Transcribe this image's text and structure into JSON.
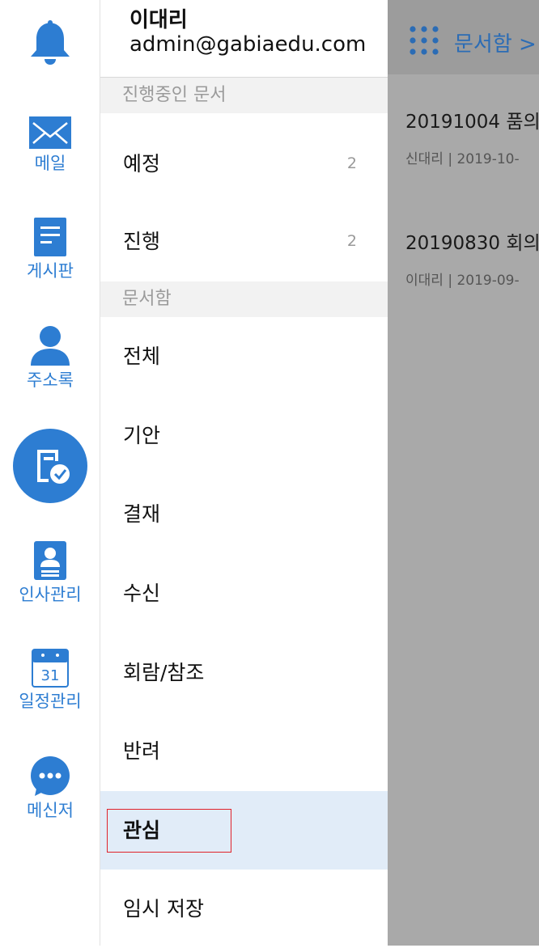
{
  "rail": {
    "items": [
      {
        "label": ""
      },
      {
        "label": "메일"
      },
      {
        "label": "게시판"
      },
      {
        "label": "주소록"
      },
      {
        "label": ""
      },
      {
        "label": "인사관리"
      },
      {
        "label": "일정관리"
      },
      {
        "label": "메신저"
      }
    ],
    "calendar_day": "31",
    "accent_color": "#2d7dd2"
  },
  "profile": {
    "name": "이대리",
    "email": "admin@gabiaedu.com"
  },
  "menu": {
    "section_in_progress": "진행중인 문서",
    "in_progress_items": [
      {
        "label": "예정",
        "count": "2"
      },
      {
        "label": "진행",
        "count": "2"
      }
    ],
    "section_docbox": "문서함",
    "docbox_items": [
      {
        "label": "전체"
      },
      {
        "label": "기안"
      },
      {
        "label": "결재"
      },
      {
        "label": "수신"
      },
      {
        "label": "회람/참조"
      },
      {
        "label": "반려"
      },
      {
        "label": "관심"
      },
      {
        "label": "임시 저장"
      }
    ],
    "selected_item": "관심",
    "selected_bg": "#e1ecf8",
    "highlight_border": "#e0222a"
  },
  "content": {
    "title": "문서함 >",
    "documents": [
      {
        "title": "20191004 품의",
        "meta": "신대리 | 2019-10-"
      },
      {
        "title": "20190830 회의",
        "meta": "이대리 | 2019-09-"
      }
    ]
  }
}
